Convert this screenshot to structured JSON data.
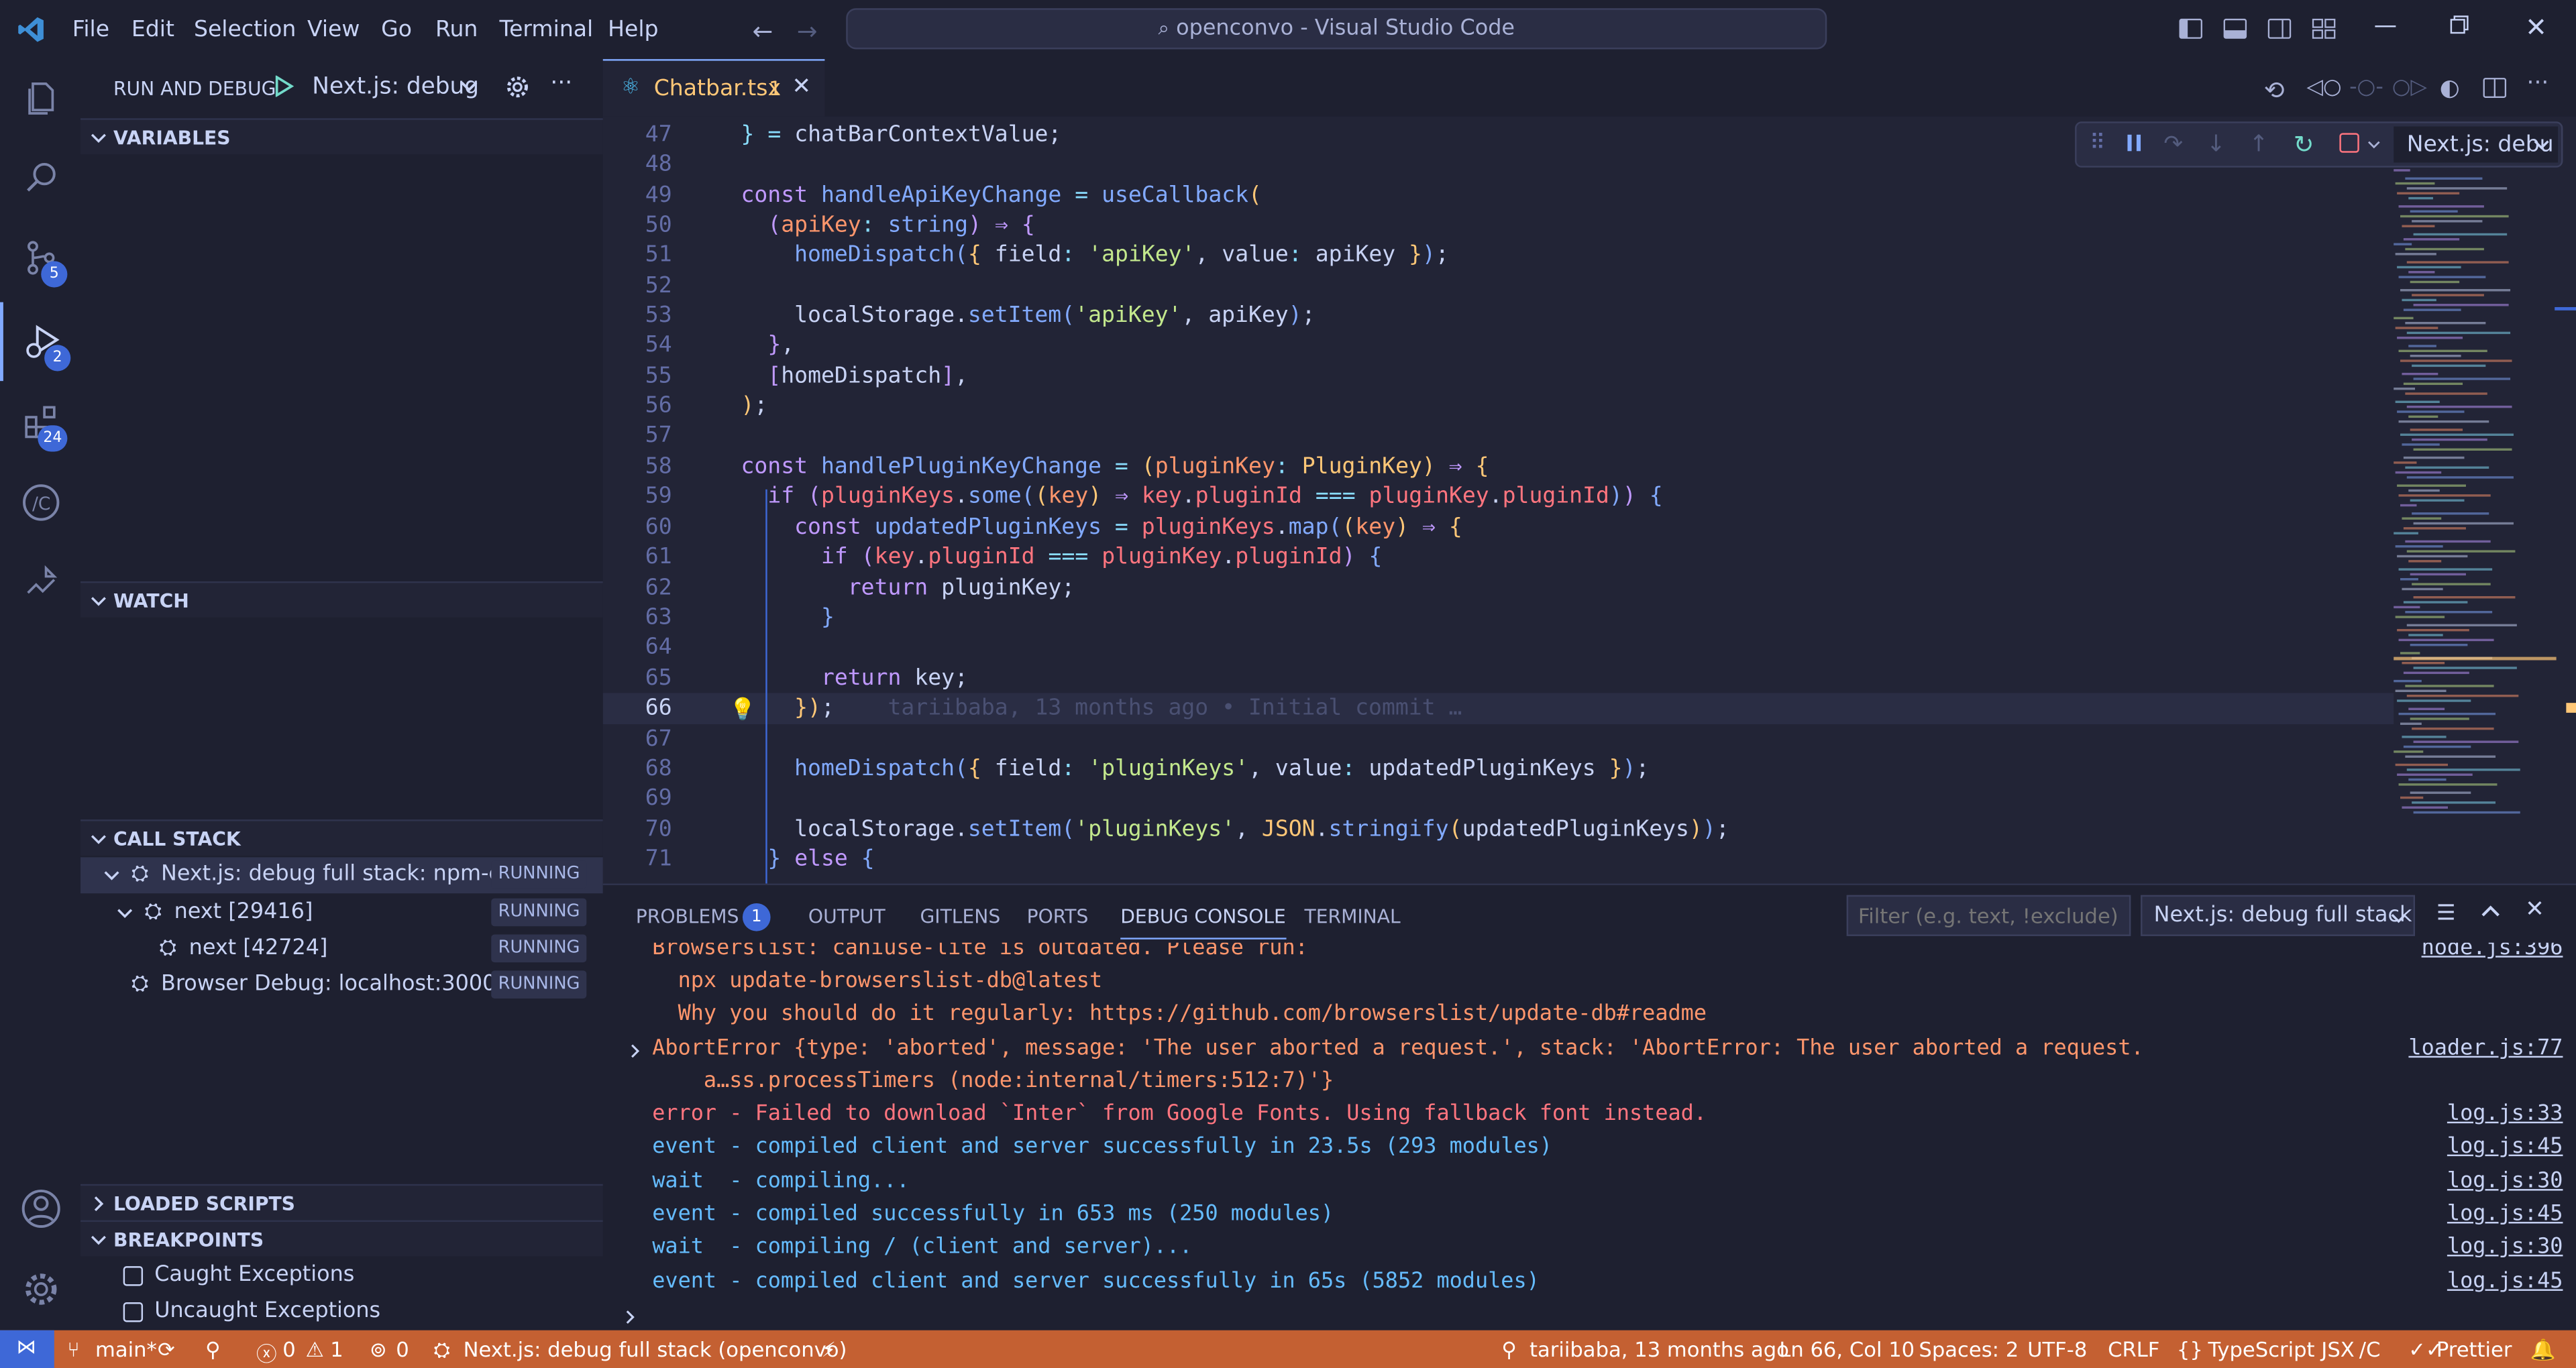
{
  "titlebar": {
    "menu": [
      "File",
      "Edit",
      "Selection",
      "View",
      "Go",
      "Run",
      "Terminal",
      "Help"
    ],
    "command_center": "openconvo - Visual Studio Code"
  },
  "activity": {
    "scm_badge": "5",
    "debug_badge": "2",
    "extensions_badge": "24"
  },
  "sidebar": {
    "title": "RUN AND DEBUG",
    "config": "Next.js: debug",
    "variables": "VARIABLES",
    "watch": "WATCH",
    "call_stack": "CALL STACK",
    "call_stack_items": [
      {
        "label": "Next.js: debug full stack: npm-c...",
        "status": "RUNNING"
      },
      {
        "label": "next [29416]",
        "status": "RUNNING"
      },
      {
        "label": "next [42724]",
        "status": "RUNNING"
      },
      {
        "label": "Browser Debug: localhost:3000",
        "status": "RUNNING"
      }
    ],
    "loaded_scripts": "LOADED SCRIPTS",
    "breakpoints": "BREAKPOINTS",
    "caught": "Caught Exceptions",
    "uncaught": "Uncaught Exceptions"
  },
  "editor": {
    "tab_name": "Chatbar.tsx",
    "tab_problems": "1",
    "debug_config": "Next.js: debu",
    "blame": "tariibaba, 13 months ago • Initial commit …",
    "line_numbers": [
      "47",
      "48",
      "49",
      "50",
      "51",
      "52",
      "53",
      "54",
      "55",
      "56",
      "57",
      "58",
      "59",
      "60",
      "61",
      "62",
      "63",
      "64",
      "65",
      "66",
      "67",
      "68",
      "69",
      "70",
      "71"
    ]
  },
  "panel": {
    "tabs": [
      "PROBLEMS",
      "OUTPUT",
      "GITLENS",
      "PORTS",
      "DEBUG CONSOLE",
      "TERMINAL"
    ],
    "problems_count": "1",
    "filter_placeholder": "Filter (e.g. text, !exclude)",
    "session": "Next.js: debug full stack",
    "logs": [
      {
        "text": "Browserslist: caniuse-lite is outdated. Please run:",
        "src": "node.js:396"
      },
      {
        "text": "  npx update-browserslist-db@latest",
        "src": ""
      },
      {
        "text": "  Why you should do it regularly: https://github.com/browserslist/update-db#readme",
        "src": ""
      },
      {
        "text": "AbortError {type: 'aborted', message: 'The user aborted a request.', stack: 'AbortError: The user aborted a request.",
        "src": "loader.js:77"
      },
      {
        "text": "    a…ss.processTimers (node:internal/timers:512:7)'}",
        "src": ""
      },
      {
        "text": "error - Failed to download `Inter` from Google Fonts. Using fallback font instead.",
        "src": "log.js:33"
      },
      {
        "text": "event - compiled client and server successfully in 23.5s (293 modules)",
        "src": "log.js:45"
      },
      {
        "text": "wait  - compiling...",
        "src": "log.js:30"
      },
      {
        "text": "event - compiled successfully in 653 ms (250 modules)",
        "src": "log.js:45"
      },
      {
        "text": "wait  - compiling / (client and server)...",
        "src": "log.js:30"
      },
      {
        "text": "event - compiled client and server successfully in 65s (5852 modules)",
        "src": "log.js:45"
      }
    ]
  },
  "status": {
    "branch": "main*",
    "errors": "0",
    "warnings": "1",
    "ports": "0",
    "debug": "Next.js: debug full stack (openconvo)",
    "blame": "tariibaba, 13 months ago",
    "position": "Ln 66, Col 10",
    "spaces": "Spaces: 2",
    "encoding": "UTF-8",
    "eol": "CRLF",
    "language": "TypeScript JSX",
    "tsversion": "/C",
    "prettier": "Prettier"
  },
  "colors": {
    "statusbar": "#c46032",
    "accent": "#82aaff",
    "running_badge": "#2f334d"
  }
}
